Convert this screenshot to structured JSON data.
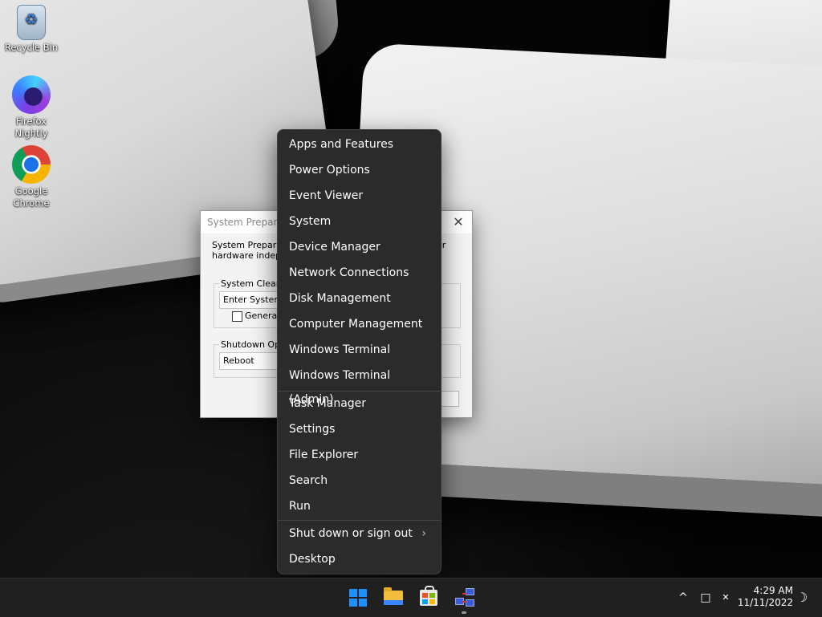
{
  "desktop": {
    "icons": [
      {
        "label_line1": "Recycle Bin",
        "label_line2": ""
      },
      {
        "label_line1": "Firefox",
        "label_line2": "Nightly"
      },
      {
        "label_line1": "Google",
        "label_line2": "Chrome"
      }
    ]
  },
  "dialog": {
    "title": "System Preparati",
    "description_line1": "System Preparati",
    "description_line1_tail": "or",
    "description_line2": "hardware indepe",
    "cleanup_group_label": "System Cleanu",
    "cleanup_action_value": "Enter System",
    "generalize_label": "Generaliz",
    "shutdown_group_label": "Shutdown Opti",
    "shutdown_value": "Reboot",
    "close_glyph": "✕"
  },
  "context_menu": {
    "group1": [
      "Apps and Features",
      "Power Options",
      "Event Viewer",
      "System",
      "Device Manager",
      "Network Connections",
      "Disk Management",
      "Computer Management",
      "Windows Terminal",
      "Windows Terminal (Admin)"
    ],
    "group2": [
      "Task Manager",
      "Settings",
      "File Explorer",
      "Search",
      "Run"
    ],
    "group3": [
      "Shut down or sign out",
      "Desktop"
    ],
    "submenu_glyph": "›"
  },
  "taskbar": {
    "apps": [
      "start-icon",
      "file-explorer-icon",
      "microsoft-store-icon",
      "network-app-icon"
    ],
    "tray": {
      "chevron": "^",
      "network_glyph": "□",
      "volume_glyph": "✕",
      "moon_glyph": "☽"
    },
    "clock": {
      "time": "4:29 AM",
      "date": "11/11/2022"
    }
  }
}
